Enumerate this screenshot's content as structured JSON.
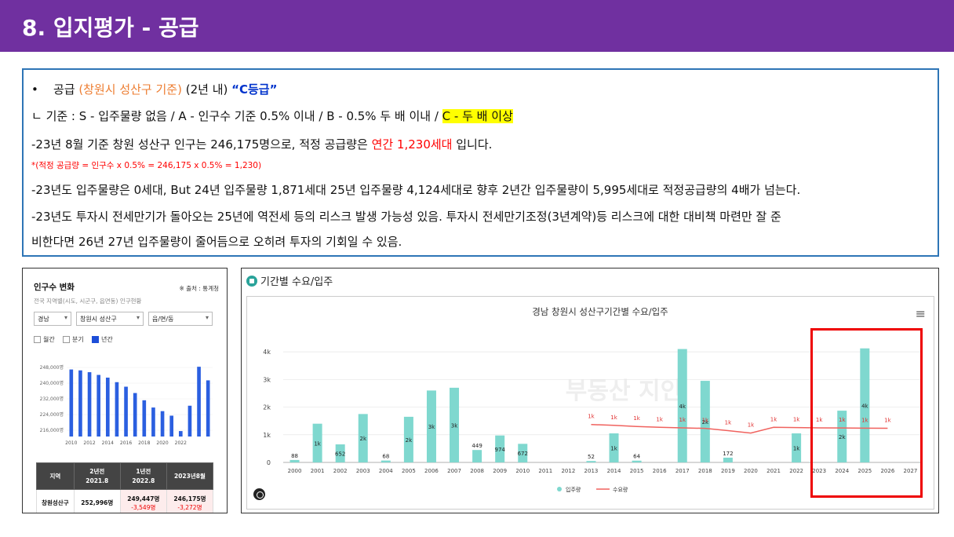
{
  "header": {
    "title": "8. 입지평가 - 공급"
  },
  "summary": {
    "line1": {
      "bullet": "•",
      "a": "공급 ",
      "b": "(창원시 성산구 기준)",
      "c": " (2년 내) ",
      "d": "“C등급”"
    },
    "line2": {
      "a": "ㄴ 기준 : S - 입주물량 없음 / A - 인구수 기준 0.5% 이내 / B - 0.5% 두 배 이내 / ",
      "b": "C - 두 배 이상"
    },
    "line3": {
      "a": "-23년 8월 기준 창원 성산구 인구는 246,175명으로, 적정 공급량은 ",
      "b": "연간 1,230세대",
      "c": " 입니다."
    },
    "line4": "*(적정 공급량 = 인구수 x 0.5% = 246,175 x 0.5% = 1,230)",
    "line5": "-23년도 입주물량은 0세대, But 24년 입주물량 1,871세대 25년 입주물량 4,124세대로 향후 2년간 입주물량이 5,995세대로 적정공급량의 4배가 넘는다.",
    "line6": "-23년도 투자시 전세만기가 돌아오는 25년에 역전세 등의 리스크 발생 가능성 있음. 투자시 전세만기조정(3년계약)등  리스크에 대한 대비책 마련만 잘 준",
    "line7": "비한다면 26년 27년 입주물량이 줄어듬으로 오히려 투자의 기회일 수 있음."
  },
  "population_panel": {
    "title": "인구수 변화",
    "source": "※ 출처 : 통계청",
    "subtitle": "전국 지역별(시도, 시군구, 읍면동) 인구현황",
    "selects": [
      "경남",
      "창원시 성산구",
      "읍/면/동"
    ],
    "checkboxes": [
      {
        "label": "월간",
        "on": false
      },
      {
        "label": "분기",
        "on": false
      },
      {
        "label": "년간",
        "on": true
      }
    ],
    "table": {
      "headers": [
        "지역",
        "2년전\n2021.8",
        "1년전\n2022.8",
        "2023년8월"
      ],
      "row": {
        "region": "창원성산구",
        "v1": "252,996명",
        "v2": "249,447명",
        "v2d": "-3,549명",
        "v3": "246,175명",
        "v3d": "-3,272명"
      }
    }
  },
  "population_chart": {
    "type": "bar",
    "y_ticks": [
      "248,000명",
      "240,000명",
      "232,000명",
      "224,000명",
      "216,000명"
    ],
    "x_ticks": [
      "2010",
      "2012",
      "2014",
      "2016",
      "2018",
      "2020",
      "2022"
    ],
    "values": [
      252000,
      251500,
      250500,
      249000,
      247500,
      245000,
      242500,
      239000,
      235000,
      231000,
      229000,
      226500,
      218000,
      232000,
      253500,
      246000
    ],
    "ylim": [
      215000,
      254000
    ],
    "color": "#2b5fe0"
  },
  "supply_panel": {
    "header": "기간별 수요/입주",
    "menu_icon": "≡"
  },
  "chart_data": {
    "type": "bar",
    "title": "경남 창원시 성산구기간별 수요/입주",
    "categories": [
      "2000",
      "2001",
      "2002",
      "2003",
      "2004",
      "2005",
      "2006",
      "2007",
      "2008",
      "2009",
      "2010",
      "2011",
      "2012",
      "2013",
      "2014",
      "2015",
      "2016",
      "2017",
      "2018",
      "2019",
      "2020",
      "2021",
      "2022",
      "2023",
      "2024",
      "2025",
      "2026",
      "2027"
    ],
    "series": [
      {
        "name": "입주량",
        "type": "bar",
        "color": "#7fd8cf",
        "values": [
          88,
          1400,
          652,
          1750,
          68,
          1650,
          2600,
          2700,
          449,
          974,
          672,
          0,
          0,
          52,
          1050,
          64,
          0,
          4100,
          2950,
          172,
          0,
          0,
          1050,
          0,
          1871,
          4124,
          0,
          0
        ],
        "labels": [
          "88",
          "1k",
          "652",
          "2k",
          "68",
          "2k",
          "3k",
          "3k",
          "449",
          "974",
          "672",
          "",
          "",
          "52",
          "1k",
          "64",
          "",
          "4k",
          "2k",
          "172",
          "",
          "",
          "1k",
          "",
          "2k",
          "4k",
          "",
          ""
        ]
      },
      {
        "name": "수요량",
        "type": "line",
        "color": "#f0625e",
        "values": [
          null,
          null,
          null,
          null,
          null,
          null,
          null,
          null,
          null,
          null,
          null,
          null,
          null,
          1370,
          1340,
          1300,
          1270,
          1250,
          1230,
          1150,
          1060,
          1270,
          1260,
          1250,
          1245,
          1240,
          1235,
          null
        ],
        "labels": [
          "",
          "",
          "",
          "",
          "",
          "",
          "",
          "",
          "",
          "",
          "",
          "",
          "",
          "1k",
          "1k",
          "1k",
          "1k",
          "1k",
          "1k",
          "1k",
          "1k",
          "1k",
          "1k",
          "1k",
          "1k",
          "1k",
          "1k",
          ""
        ]
      }
    ],
    "y_ticks": [
      "4k",
      "3k",
      "2k",
      "1k",
      "0"
    ],
    "ylim": [
      0,
      4400
    ],
    "watermark": "부동산 지인",
    "legend": "bottom"
  }
}
